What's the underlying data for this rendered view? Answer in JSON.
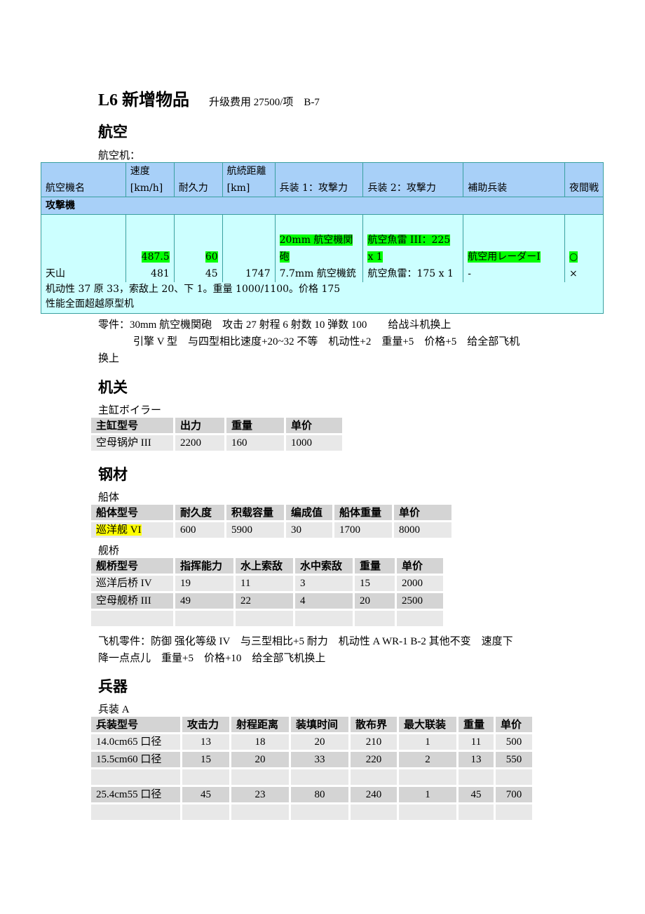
{
  "title": {
    "main": "L6 新增物品",
    "sub": "升级费用 27500/项　B-7"
  },
  "aviation": {
    "heading": "航空",
    "caption": "航空机：",
    "table": {
      "headers": [
        "航空機名",
        "速度[km/h]",
        "耐久力",
        "航続距離[km]",
        "兵装 1：攻撃力",
        "兵装 2：攻撃力",
        "補助兵装",
        "夜間戦"
      ],
      "category": "攻撃機",
      "row": {
        "name": "天山",
        "speed_new": "487.5",
        "speed": "481",
        "hp_new": "60",
        "hp": "45",
        "range": "1747",
        "weapon1_new": "20mm 航空機関砲",
        "weapon1": "7.7mm 航空機銃",
        "weapon2_new": "航空魚雷 III：225 x 1",
        "weapon2": "航空魚雷：175 x 1",
        "aux_new": "航空用レーダーI",
        "aux": "-",
        "night_new": "○",
        "night": "×"
      },
      "notes": [
        "机动性 37 原 33，索敌上 20、下 1。重量 1000/1100。价格 175",
        "性能全面超越原型机"
      ]
    },
    "parts_line1": "零件：30mm 航空機関砲　攻击 27  射程 6  射数 10  弹数 100　　给战斗机换上",
    "parts_line2": "引擎 V 型　与四型相比速度+20~32 不等　机动性+2　重量+5　价格+5　给全部飞机",
    "parts_line3": "换上"
  },
  "engine": {
    "heading": "机关",
    "caption": "主缸ボイラー",
    "headers": [
      "主缸型号",
      "出力",
      "重量",
      "单价"
    ],
    "rows": [
      [
        "空母锅炉 III",
        "2200",
        "160",
        "1000"
      ]
    ]
  },
  "steel": {
    "heading": "钢材",
    "hull_caption": "船体",
    "hull_headers": [
      "船体型号",
      "耐久度",
      "积载容量",
      "编成值",
      "船体重量",
      "单价"
    ],
    "hull_rows": [
      [
        "巡洋舰 VI",
        "600",
        "5900",
        "30",
        "1700",
        "8000"
      ]
    ],
    "bridge_caption": "舰桥",
    "bridge_headers": [
      "舰桥型号",
      "指挥能力",
      "水上索敌",
      "水中索敌",
      "重量",
      "单价"
    ],
    "bridge_rows": [
      [
        "巡洋后桥 IV",
        "19",
        "11",
        "3",
        "15",
        "2000"
      ],
      [
        "空母舰桥 III",
        "49",
        "22",
        "4",
        "20",
        "2500"
      ]
    ],
    "parts_line1": "飞机零件：防御  强化等级 IV　与三型相比+5 耐力　机动性 A WR-1 B-2 其他不变　速度下",
    "parts_line2": "降一点点儿　重量+5　价格+10　给全部飞机换上"
  },
  "weapons": {
    "heading": "兵器",
    "caption": "兵装 A",
    "headers": [
      "兵装型号",
      "攻击力",
      "射程距离",
      "装填时间",
      "散布界",
      "最大联装",
      "重量",
      "单价"
    ],
    "rows": [
      [
        "14.0cm65 口径",
        "13",
        "18",
        "20",
        "210",
        "1",
        "11",
        "500"
      ],
      [
        "15.5cm60 口径",
        "15",
        "20",
        "33",
        "220",
        "2",
        "13",
        "550"
      ],
      [
        "25.4cm55 口径",
        "45",
        "23",
        "80",
        "240",
        "1",
        "45",
        "700"
      ]
    ]
  }
}
